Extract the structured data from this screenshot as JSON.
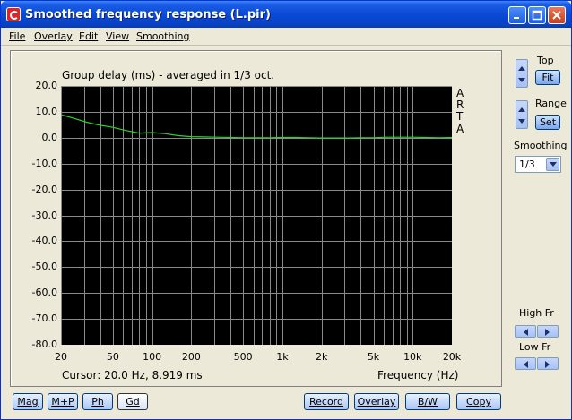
{
  "window": {
    "title": "Smoothed frequency response (L.pir)"
  },
  "menu": [
    {
      "label": "File"
    },
    {
      "label": "Overlay"
    },
    {
      "label": "Edit"
    },
    {
      "label": "View"
    },
    {
      "label": "Smoothing"
    }
  ],
  "plot": {
    "title": "Group delay (ms) - averaged in 1/3 oct.",
    "arta": [
      "A",
      "R",
      "T",
      "A"
    ],
    "cursor": "Cursor: 20.0 Hz, 8.919 ms",
    "xlabel": "Frequency (Hz)",
    "y_ticks": [
      "20.0",
      "10.0",
      "0.0",
      "-10.0",
      "-20.0",
      "-30.0",
      "-40.0",
      "-50.0",
      "-60.0",
      "-70.0",
      "-80.0"
    ],
    "x_ticks": [
      "20",
      "50",
      "100",
      "200",
      "500",
      "1k",
      "2k",
      "5k",
      "10k",
      "20k"
    ],
    "grid_color": "#8a8a8a",
    "trace_color": "#2fd12f"
  },
  "chart_data": {
    "type": "line",
    "title": "Group delay (ms) - averaged in 1/3 oct.",
    "xlabel": "Frequency (Hz)",
    "ylabel": "",
    "x_scale": "log",
    "xlim": [
      20,
      20000
    ],
    "ylim": [
      -80,
      20
    ],
    "grid": true,
    "series": [
      {
        "x": [
          20,
          25,
          31.5,
          40,
          50,
          63,
          80,
          100,
          125,
          160,
          200,
          250,
          315,
          400,
          500,
          630,
          800,
          1000,
          1250,
          1600,
          2000,
          2500,
          3150,
          4000,
          5000,
          6300,
          8000,
          10000,
          12500,
          16000,
          20000
        ],
        "values": [
          8.9,
          7.5,
          6.0,
          4.8,
          4.0,
          2.8,
          1.8,
          2.0,
          1.6,
          0.8,
          0.4,
          0.3,
          0.2,
          0.1,
          0.0,
          0.0,
          0.0,
          0.1,
          0.1,
          0.0,
          -0.1,
          -0.1,
          -0.1,
          0.0,
          0.0,
          0.2,
          0.2,
          0.2,
          0.1,
          0.0,
          0.1
        ]
      }
    ]
  },
  "side": {
    "top_label": "Top",
    "fit_label": "Fit",
    "range_label": "Range",
    "set_label": "Set",
    "smoothing_label": "Smoothing",
    "smoothing_value": "1/3",
    "high_fr_label": "High Fr",
    "low_fr_label": "Low Fr"
  },
  "bottom_buttons": [
    {
      "label": "Mag"
    },
    {
      "label": "M+P"
    },
    {
      "label": "Ph"
    },
    {
      "label": "Gd"
    },
    {
      "label": "Record"
    },
    {
      "label": "Overlay"
    },
    {
      "label": "B/W"
    },
    {
      "label": "Copy"
    }
  ]
}
